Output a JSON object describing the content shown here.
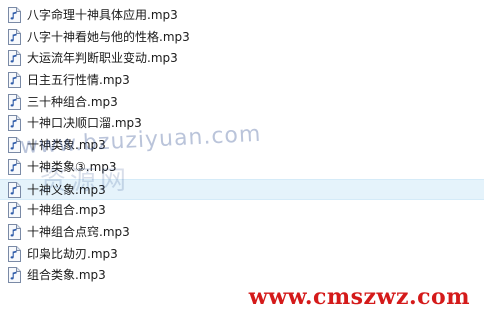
{
  "files": [
    {
      "name": "八字命理十神具体应用.mp3",
      "selected": false
    },
    {
      "name": "八字十神看她与他的性格.mp3",
      "selected": false
    },
    {
      "name": "大运流年判断职业变动.mp3",
      "selected": false
    },
    {
      "name": "日主五行性情.mp3",
      "selected": false
    },
    {
      "name": "三十种组合.mp3",
      "selected": false
    },
    {
      "name": "十神口决顺口溜.mp3",
      "selected": false
    },
    {
      "name": "十神类象.mp3",
      "selected": false
    },
    {
      "name": "十神类象③.mp3",
      "selected": false
    },
    {
      "name": "十神义象.mp3",
      "selected": true
    },
    {
      "name": "十神组合.mp3",
      "selected": false
    },
    {
      "name": "十神组合点窍.mp3",
      "selected": false
    },
    {
      "name": "印枭比劫刃.mp3",
      "selected": false
    },
    {
      "name": "组合类象.mp3",
      "selected": false
    }
  ],
  "watermark": {
    "center_text": "www.bzuziyuan.com",
    "center_cn": "资源网",
    "site_text": "www.cmszwz.com",
    "site_color": "#d41a1a"
  },
  "icon": "audio-file-icon",
  "colors": {
    "selection": "#e5f3fb",
    "text": "#1a1a1a"
  }
}
